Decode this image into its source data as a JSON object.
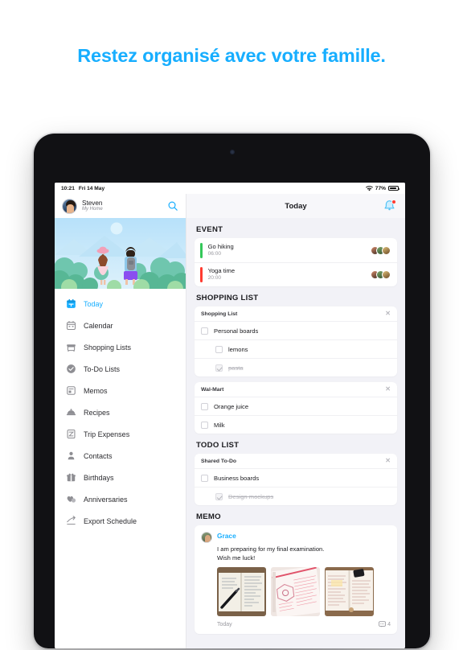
{
  "headline": "Restez organisé avec votre famille.",
  "brand_color": "#17AEFF",
  "status_bar": {
    "time": "10:21",
    "date": "Fri 14 May",
    "battery_percent": "77%",
    "wifi_icon": "wifi-icon",
    "battery_icon": "battery-icon"
  },
  "sidebar": {
    "profile": {
      "name": "Steven",
      "subtitle": "My Home",
      "avatar_icon": "avatar",
      "search_icon": "search-icon"
    },
    "hero_illustration": "hikers-illustration",
    "items": [
      {
        "label": "Today",
        "icon": "calendar-today-icon",
        "active": true
      },
      {
        "label": "Calendar",
        "icon": "calendar-icon",
        "active": false
      },
      {
        "label": "Shopping Lists",
        "icon": "shopping-cart-icon",
        "active": false
      },
      {
        "label": "To-Do Lists",
        "icon": "check-circle-icon",
        "active": false
      },
      {
        "label": "Memos",
        "icon": "note-icon",
        "active": false
      },
      {
        "label": "Recipes",
        "icon": "cloche-icon",
        "active": false
      },
      {
        "label": "Trip Expenses",
        "icon": "receipt-icon",
        "active": false
      },
      {
        "label": "Contacts",
        "icon": "person-icon",
        "active": false
      },
      {
        "label": "Birthdays",
        "icon": "gift-icon",
        "active": false
      },
      {
        "label": "Anniversaries",
        "icon": "heart-icon",
        "active": false
      },
      {
        "label": "Export Schedule",
        "icon": "share-icon",
        "active": false
      }
    ]
  },
  "content": {
    "title": "Today",
    "bell_icon": "bell-icon",
    "has_notification": true,
    "sections": {
      "event": {
        "heading": "EVENT",
        "rows": [
          {
            "title": "Go hiking",
            "time": "06:00",
            "color": "#34C759"
          },
          {
            "title": "Yoga time",
            "time": "20:00",
            "color": "#FF3B30"
          }
        ]
      },
      "shopping": {
        "heading": "SHOPPING LIST",
        "cards": [
          {
            "name": "Shopping List",
            "close_icon": "close-icon",
            "items": [
              {
                "label": "Personal boards",
                "checked": false,
                "indent": false
              },
              {
                "label": "lemons",
                "checked": false,
                "indent": true
              },
              {
                "label": "pasta",
                "checked": true,
                "indent": true
              }
            ]
          },
          {
            "name": "Wal-Mart",
            "close_icon": "close-icon",
            "items": [
              {
                "label": "Orange juice",
                "checked": false,
                "indent": false
              },
              {
                "label": "Milk",
                "checked": false,
                "indent": false
              }
            ]
          }
        ]
      },
      "todo": {
        "heading": "TODO LIST",
        "cards": [
          {
            "name": "Shared To-Do",
            "close_icon": "close-icon",
            "items": [
              {
                "label": "Business boards",
                "checked": false,
                "indent": false
              },
              {
                "label": "Design mockups",
                "checked": true,
                "indent": true
              }
            ]
          }
        ]
      },
      "memo": {
        "heading": "MEMO",
        "author": "Grace",
        "text": "I am preparing for my final examination.\nWish me luck!",
        "images": [
          "notebook-pen-photo",
          "pink-planner-photo",
          "study-notes-photo"
        ],
        "timestamp": "Today",
        "comment_count": "4",
        "comment_icon": "comment-icon"
      }
    }
  }
}
